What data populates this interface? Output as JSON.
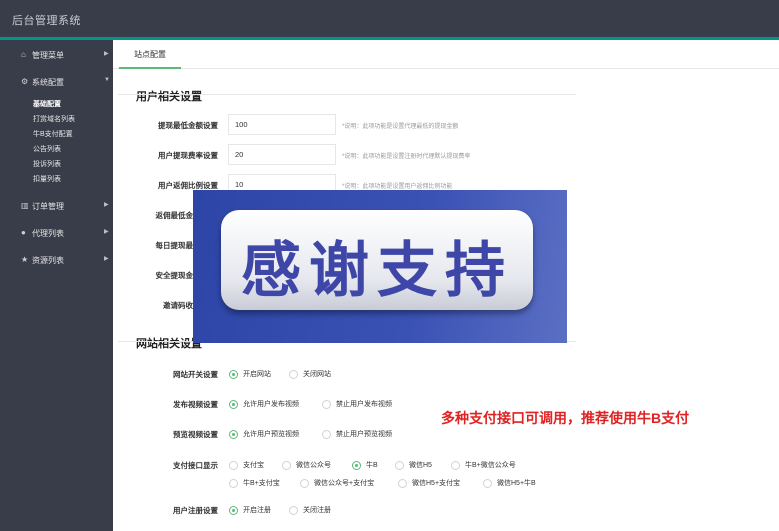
{
  "app": {
    "title": "后台管理系统"
  },
  "sidebar": {
    "items": [
      {
        "icon": "home-icon",
        "glyph": "⌂",
        "label": "管理菜单"
      },
      {
        "icon": "gears-icon",
        "glyph": "⚙",
        "label": "系统配置"
      },
      {
        "icon": "bar-chart-icon",
        "glyph": "▥",
        "label": "订单管理"
      },
      {
        "icon": "user-icon",
        "glyph": "●",
        "label": "代理列表"
      },
      {
        "icon": "star-icon",
        "glyph": "★",
        "label": "资源列表"
      }
    ],
    "subitems": [
      "基础配置",
      "打赏域名列表",
      "牛B支付配置",
      "公告列表",
      "投诉列表",
      "扣量列表"
    ]
  },
  "tabs": [
    {
      "label": "站点配置"
    }
  ],
  "user_section": {
    "title": "用户相关设置",
    "fields": [
      {
        "label": "提现最低金额设置",
        "value": "100",
        "help": "*说明：此项功能是设置代理最低的提现金额"
      },
      {
        "label": "用户提现费率设置",
        "value": "20",
        "help": "*说明：此项功能是设置注册时代理默认提现费率"
      },
      {
        "label": "用户返佣比例设置",
        "value": "10",
        "help": "*说明：此项功能是设置用户返佣比例功能"
      },
      {
        "label": "返佣最低金"
      },
      {
        "label": "每日提现最"
      },
      {
        "label": "安全提现金"
      },
      {
        "label": "邀请码收"
      }
    ]
  },
  "site_section": {
    "title": "网站相关设置",
    "rows": [
      {
        "label": "网站开关设置",
        "options": [
          {
            "text": "开启网站",
            "checked": true
          },
          {
            "text": "关闭网站",
            "checked": false
          }
        ]
      },
      {
        "label": "发布视频设置",
        "options": [
          {
            "text": "允许用户发布视频",
            "checked": true
          },
          {
            "text": "禁止用户发布视频",
            "checked": false
          }
        ]
      },
      {
        "label": "预览视频设置",
        "options": [
          {
            "text": "允许用户预览视频",
            "checked": true
          },
          {
            "text": "禁止用户预览视频",
            "checked": false
          }
        ]
      },
      {
        "label": "支付接口显示",
        "options": [
          {
            "text": "支付宝",
            "checked": false
          },
          {
            "text": "微信公众号",
            "checked": false
          },
          {
            "text": "牛B",
            "checked": true
          },
          {
            "text": "微信H5",
            "checked": false
          },
          {
            "text": "牛B+微信公众号",
            "checked": false
          },
          {
            "text": "牛B+支付宝",
            "checked": false
          },
          {
            "text": "微信公众号+支付宝",
            "checked": false
          },
          {
            "text": "微信H5+支付宝",
            "checked": false
          },
          {
            "text": "微信H5+牛B",
            "checked": false
          }
        ]
      },
      {
        "label": "用户注册设置",
        "options": [
          {
            "text": "开启注册",
            "checked": true
          },
          {
            "text": "关闭注册",
            "checked": false
          }
        ]
      }
    ]
  },
  "overlay": {
    "banner_text": "感谢支持",
    "promo_text": "多种支付接口可调用，推荐使用牛B支付"
  },
  "colors": {
    "sidebar": "#393d49",
    "accent": "#009688",
    "radio_on": "#5fb878",
    "promo": "#e02222",
    "banner": "#2c45a6"
  }
}
